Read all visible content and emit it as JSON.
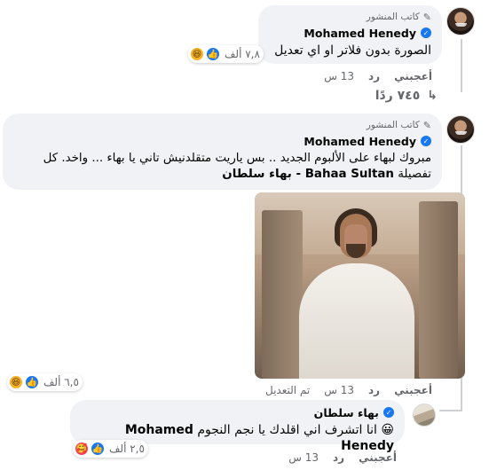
{
  "comments": [
    {
      "author_badge": "كاتب المنشور",
      "author_name": "Mohamed Henedy",
      "text": "الصورة بدون فلاتر او اي تعديل",
      "reaction_count": "٧,٨ ألف",
      "actions": {
        "like": "أعجبني",
        "reply": "رد",
        "time": "13 س"
      },
      "replies_link": "٧٤٥ ردًا"
    },
    {
      "author_badge": "كاتب المنشور",
      "author_name": "Mohamed Henedy",
      "text_line1": "مبروك لبهاء على الألبوم الجديد .. بس ياريت متقلدنيش تاني يا بهاء ... واخد. كل",
      "text_line2_prefix": "تفصيلة ",
      "mention": "Bahaa Sultan - بهاء سلطان",
      "reaction_count": "٦,٥ ألف",
      "actions": {
        "like": "أعجبني",
        "reply": "رد",
        "time": "13 س",
        "edited": "تم التعديل"
      }
    },
    {
      "author_name": "بهاء سلطان",
      "text": "انا اتشرف اني اقلدك يا نجم النجوم",
      "mention": "Mohamed Henedy",
      "emoji": "😀",
      "reaction_count": "٢,٥ ألف",
      "actions": {
        "like": "أعجبني",
        "reply": "رد",
        "time": "13 س"
      }
    }
  ],
  "icons": {
    "pen": "✎",
    "verified": "✓",
    "like": "👍",
    "haha": "😆",
    "love": "❤",
    "care": "🥰",
    "reply_arrow": "↳"
  },
  "colors": {
    "bubble": "#f0f2f5",
    "verified": "#1877f2",
    "secondary_text": "#65676b",
    "thread_line": "#ced0d4"
  }
}
